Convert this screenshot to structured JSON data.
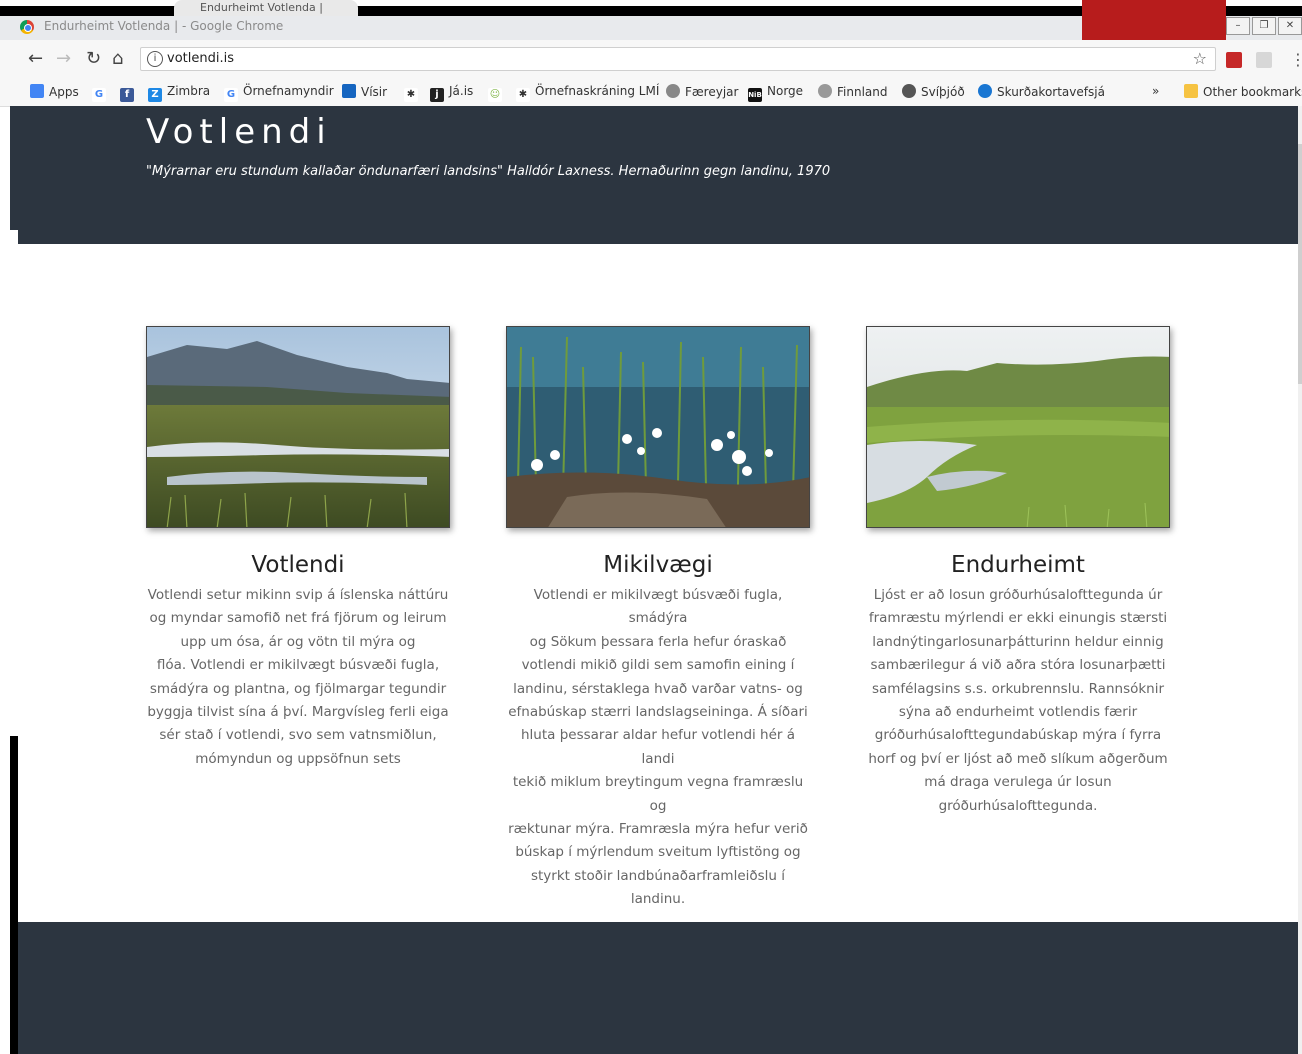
{
  "browser": {
    "tab_title": "Endurheimt Votlenda |",
    "window_title": "Endurheimt Votlenda | - Google Chrome",
    "url": "votlendi.is",
    "info_glyph": "i",
    "bookmarks": [
      {
        "label": "Apps",
        "icon": "apps-grid-icon",
        "color": "#4285f4"
      },
      {
        "label": "",
        "icon": "google-icon",
        "color": "#4285f4"
      },
      {
        "label": "",
        "icon": "facebook-icon",
        "color": "#3b5998"
      },
      {
        "label": "Zimbra",
        "icon": "zimbra-icon",
        "color": "#1e88e5"
      },
      {
        "label": "Örnefnamyndir",
        "icon": "google-icon",
        "color": "#4285f4"
      },
      {
        "label": "Vísir",
        "icon": "visir-icon",
        "color": "#1565c0"
      },
      {
        "label": "",
        "icon": "lmi-icon",
        "color": "#333333"
      },
      {
        "label": "Já.is",
        "icon": "ja-icon",
        "color": "#222222"
      },
      {
        "label": "",
        "icon": "smile-icon",
        "color": "#7cb342"
      },
      {
        "label": "Örnefnaskráning LMÍ",
        "icon": "lmi-icon",
        "color": "#333333"
      },
      {
        "label": "Færeyjar",
        "icon": "globe-icon",
        "color": "#666666"
      },
      {
        "label": "Norge",
        "icon": "nib-icon",
        "color": "#111111"
      },
      {
        "label": "Finnland",
        "icon": "globe-icon",
        "color": "#777777"
      },
      {
        "label": "Svíþjóð",
        "icon": "globe-icon",
        "color": "#555555"
      },
      {
        "label": "Skurðakortavefsjá",
        "icon": "map-icon",
        "color": "#1976d2"
      }
    ],
    "overflow": "»",
    "other_bookmarks": "Other bookmarks"
  },
  "hero": {
    "title": "Votlendi",
    "quote": "\"Mýrarnar eru stundum kallaðar öndunarfæri landsins\" Halldór Laxness. Hernaðurinn gegn landinu, 1970"
  },
  "cards": [
    {
      "title": "Votlendi",
      "lines": [
        "Votlendi setur mikinn svip á íslenska náttúru",
        "og myndar samofið net frá fjörum og leirum",
        "upp um ósa, ár og vötn til mýra og",
        "flóa. Votlendi er mikilvægt búsvæði fugla,",
        "smádýra og plantna, og fjölmargar tegundir",
        "byggja tilvist sína á því. Margvísleg ferli eiga",
        "sér stað í votlendi, svo sem vatnsmiðlun,",
        "mómyndun og uppsöfnun sets"
      ]
    },
    {
      "title": "Mikilvægi",
      "lines": [
        "Votlendi er mikilvægt búsvæði fugla, smádýra",
        "og Sökum þessara ferla hefur óraskað",
        "votlendi mikið gildi sem samofin eining í",
        "landinu, sérstaklega hvað varðar vatns- og",
        "efnabúskap stærri landslagseininga. Á síðari",
        "hluta þessarar aldar hefur votlendi hér á landi",
        "tekið miklum breytingum vegna framræslu og",
        "ræktunar mýra. Framræsla mýra hefur verið",
        "búskap í mýrlendum sveitum lyftistöng og",
        "styrkt stoðir landbúnaðarframleiðslu í",
        "landinu."
      ]
    },
    {
      "title": "Endurheimt",
      "lines": [
        "Ljóst er að losun gróðurhúsalofttegunda úr",
        "framræstu mýrlendi er ekki einungis stærsti",
        "landnýtingarlosunarþátturinn heldur einnig",
        "sambærilegur á við aðra stóra losunarþætti",
        "samfélagsins s.s. orkubrennslu. Rannsóknir",
        "sýna að endurheimt votlendis færir",
        "gróðurhúsalofttegundabúskap mýra í fyrra",
        "horf og því er ljóst að með slíkum aðgerðum",
        "má draga verulega úr losun",
        "gróðurhúsalofttegunda."
      ]
    }
  ],
  "colors": {
    "hero_bg": "#2c3540",
    "footer_bg": "#2c3540",
    "text_muted": "#666666",
    "title_text": "#ffffff",
    "red_overlay": "#b71c1c"
  }
}
